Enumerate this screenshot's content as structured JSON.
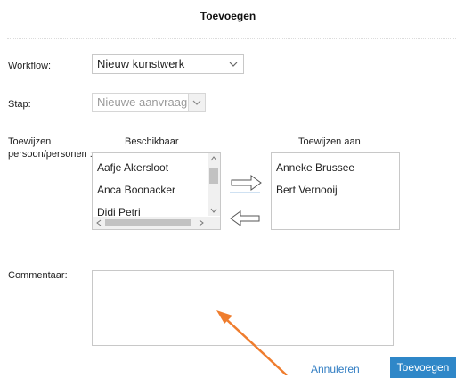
{
  "dialog": {
    "title": "Toevoegen"
  },
  "workflow": {
    "label": "Workflow:",
    "value": "Nieuw kunstwerk"
  },
  "stap": {
    "label": "Stap:",
    "value": "Nieuwe aanvraag"
  },
  "assign": {
    "label_line1": "Toewijzen",
    "label_line2": "persoon/personen :",
    "available_header": "Beschikbaar",
    "assigned_header": "Toewijzen aan",
    "available": [
      "Aafje Akersloot",
      "Anca Boonacker",
      "Didi Petri"
    ],
    "assigned": [
      "Anneke Brussee",
      "Bert Vernooij"
    ]
  },
  "comment": {
    "label": "Commentaar:",
    "value": ""
  },
  "buttons": {
    "cancel": "Annuleren",
    "add": "Toevoegen"
  },
  "colors": {
    "primary": "#2f87c8",
    "link": "#2f7cc2",
    "annotation_arrow": "#ef7d2e"
  }
}
